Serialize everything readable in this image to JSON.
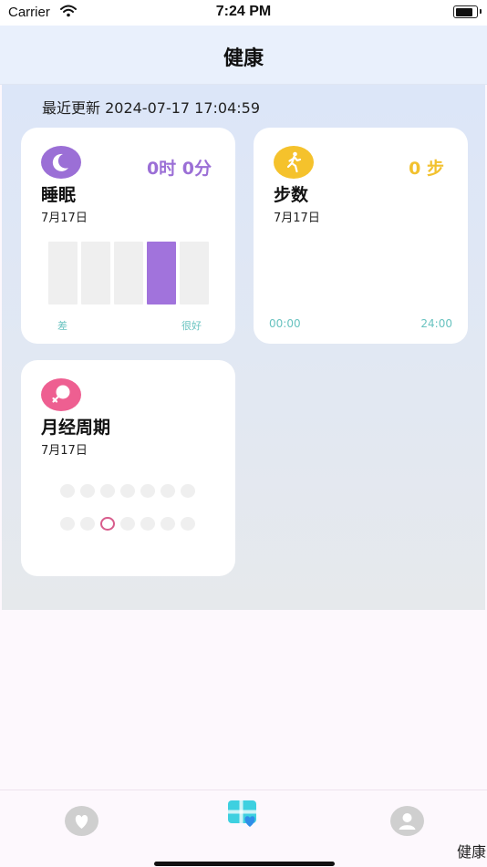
{
  "status_bar": {
    "carrier": "Carrier",
    "time": "7:24 PM"
  },
  "header": {
    "title": "健康"
  },
  "last_updated": "最近更新 2024-07-17 17:04:59",
  "cards": {
    "sleep": {
      "title": "睡眠",
      "date": "7月17日",
      "value": "0时 0分",
      "scale_low": "差",
      "scale_high": "很好",
      "quality_level_index": 4,
      "quality_levels": 5,
      "icon": "moon-icon",
      "color": "#9b6fd6"
    },
    "steps": {
      "title": "步数",
      "date": "7月17日",
      "value": "0 步",
      "axis_start": "00:00",
      "axis_end": "24:00",
      "icon": "walking-person-icon",
      "color": "#f5c22c"
    },
    "cycle": {
      "title": "月经周期",
      "date": "7月17日",
      "icon": "female-symbol-icon",
      "color": "#ee5f91",
      "highlighted_day_index": 10,
      "day_count": 14
    }
  },
  "tab_bar": {
    "tabs": [
      {
        "icon": "heart-icon",
        "label": ""
      },
      {
        "icon": "health-tab-icon",
        "label": "健康",
        "selected": true
      },
      {
        "icon": "profile-icon",
        "label": ""
      }
    ]
  }
}
